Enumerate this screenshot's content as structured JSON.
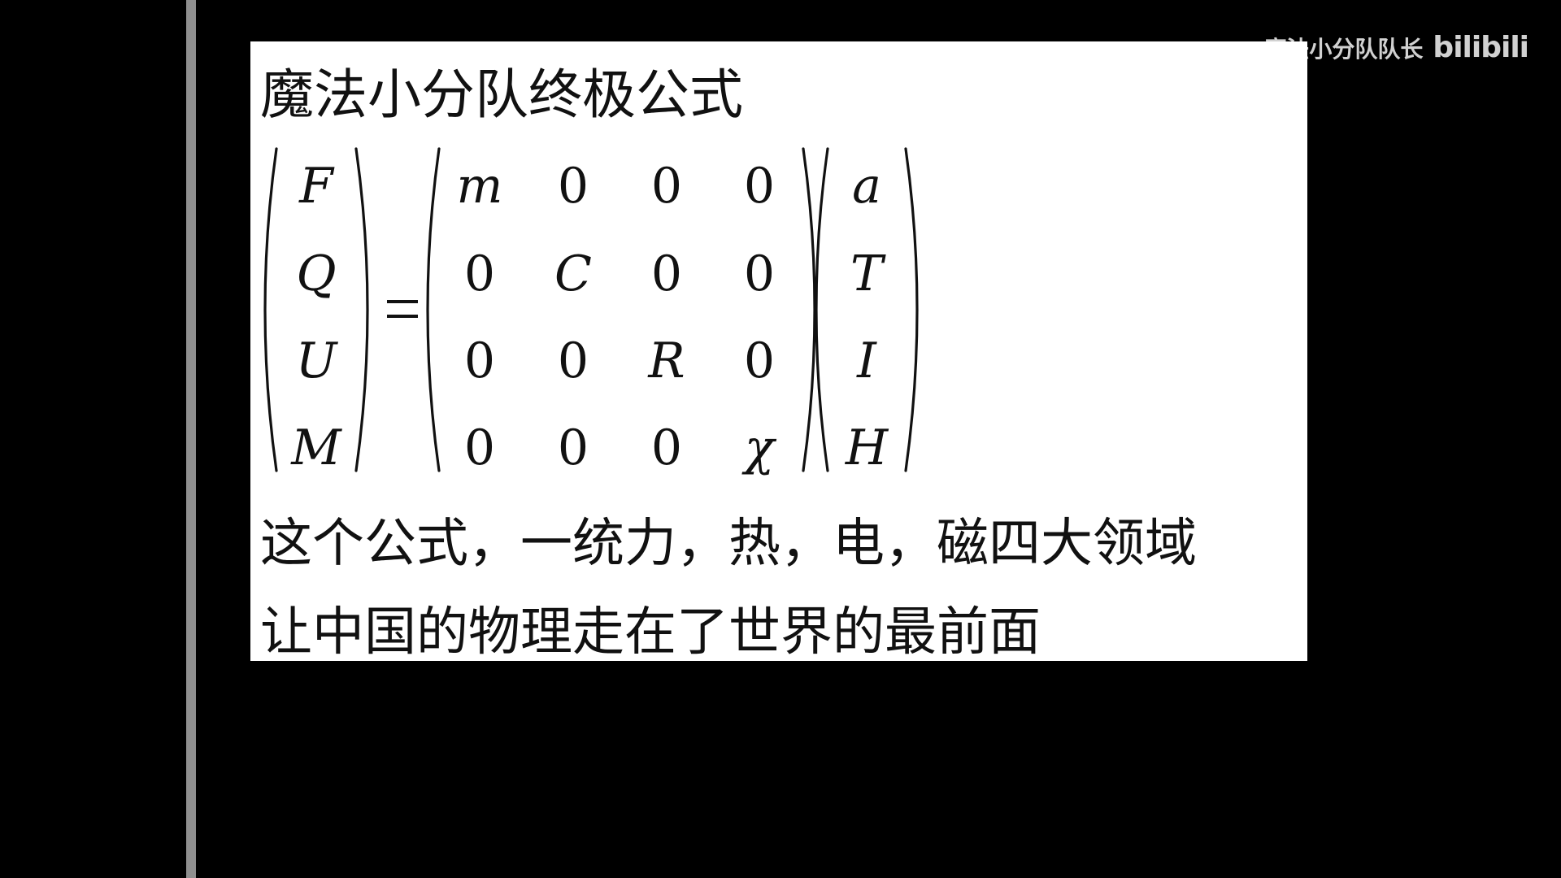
{
  "watermark": {
    "author": "魔法小分队队长",
    "logo": "bilibili"
  },
  "slide": {
    "title": "魔法小分队终极公式",
    "line1": "这个公式，一统力，热，电，磁四大领域",
    "line2": "让中国的物理走在了世界的最前面"
  },
  "equation": {
    "left_vector": [
      "F",
      "Q",
      "U",
      "M"
    ],
    "equals": "=",
    "matrix": [
      [
        "m",
        "0",
        "0",
        "0"
      ],
      [
        "0",
        "C",
        "0",
        "0"
      ],
      [
        "0",
        "0",
        "R",
        "0"
      ],
      [
        "0",
        "0",
        "0",
        "χ"
      ]
    ],
    "right_vector": [
      "a",
      "T",
      "I",
      "H"
    ]
  },
  "colors": {
    "background": "#000000",
    "slide": "#ffffff",
    "text": "#111111",
    "side_bar": "#8f8f8f"
  }
}
